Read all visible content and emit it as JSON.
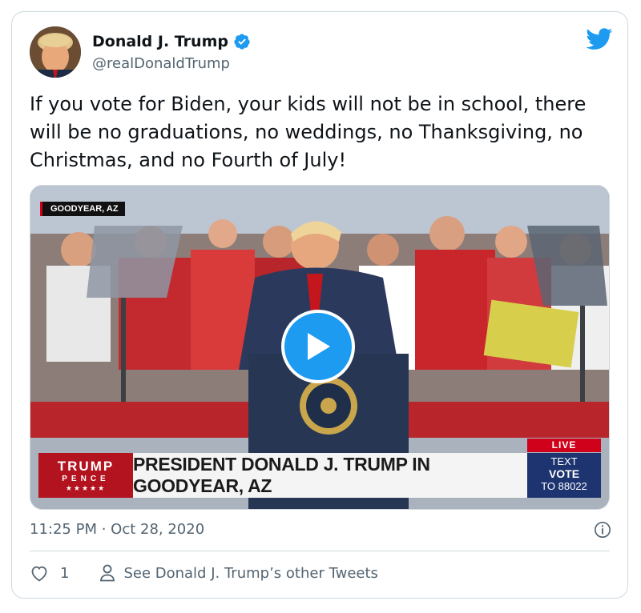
{
  "author": {
    "name": "Donald J. Trump",
    "handle": "@realDonaldTrump",
    "verified": true
  },
  "tweet": {
    "text": "If you vote for Biden, your kids will not be in school, there will be no graduations, no weddings, no Thanksgiving, no Christmas, and no Fourth of July!",
    "timestamp": "11:25 PM · Oct 28, 2020"
  },
  "video": {
    "location_tag": "GOODYEAR, AZ",
    "logo_line1": "TRUMP",
    "logo_line2": "PENCE",
    "logo_line3": "★★★★★",
    "headline": "PRESIDENT DONALD J. TRUMP IN GOODYEAR, AZ",
    "live_label": "LIVE",
    "text_label": "TEXT",
    "vote_label": "VOTE",
    "to_label": "TO 88022"
  },
  "footer": {
    "like_count": "1",
    "other_tweets_label": "See Donald J. Trump’s other Tweets"
  },
  "colors": {
    "twitter_blue": "#1d9bf0",
    "text_primary": "#0f1419",
    "text_secondary": "#536471",
    "border": "#cfd9de"
  },
  "icons": [
    "verified-badge-icon",
    "twitter-bird-icon",
    "play-icon",
    "info-icon",
    "heart-icon",
    "person-icon"
  ]
}
